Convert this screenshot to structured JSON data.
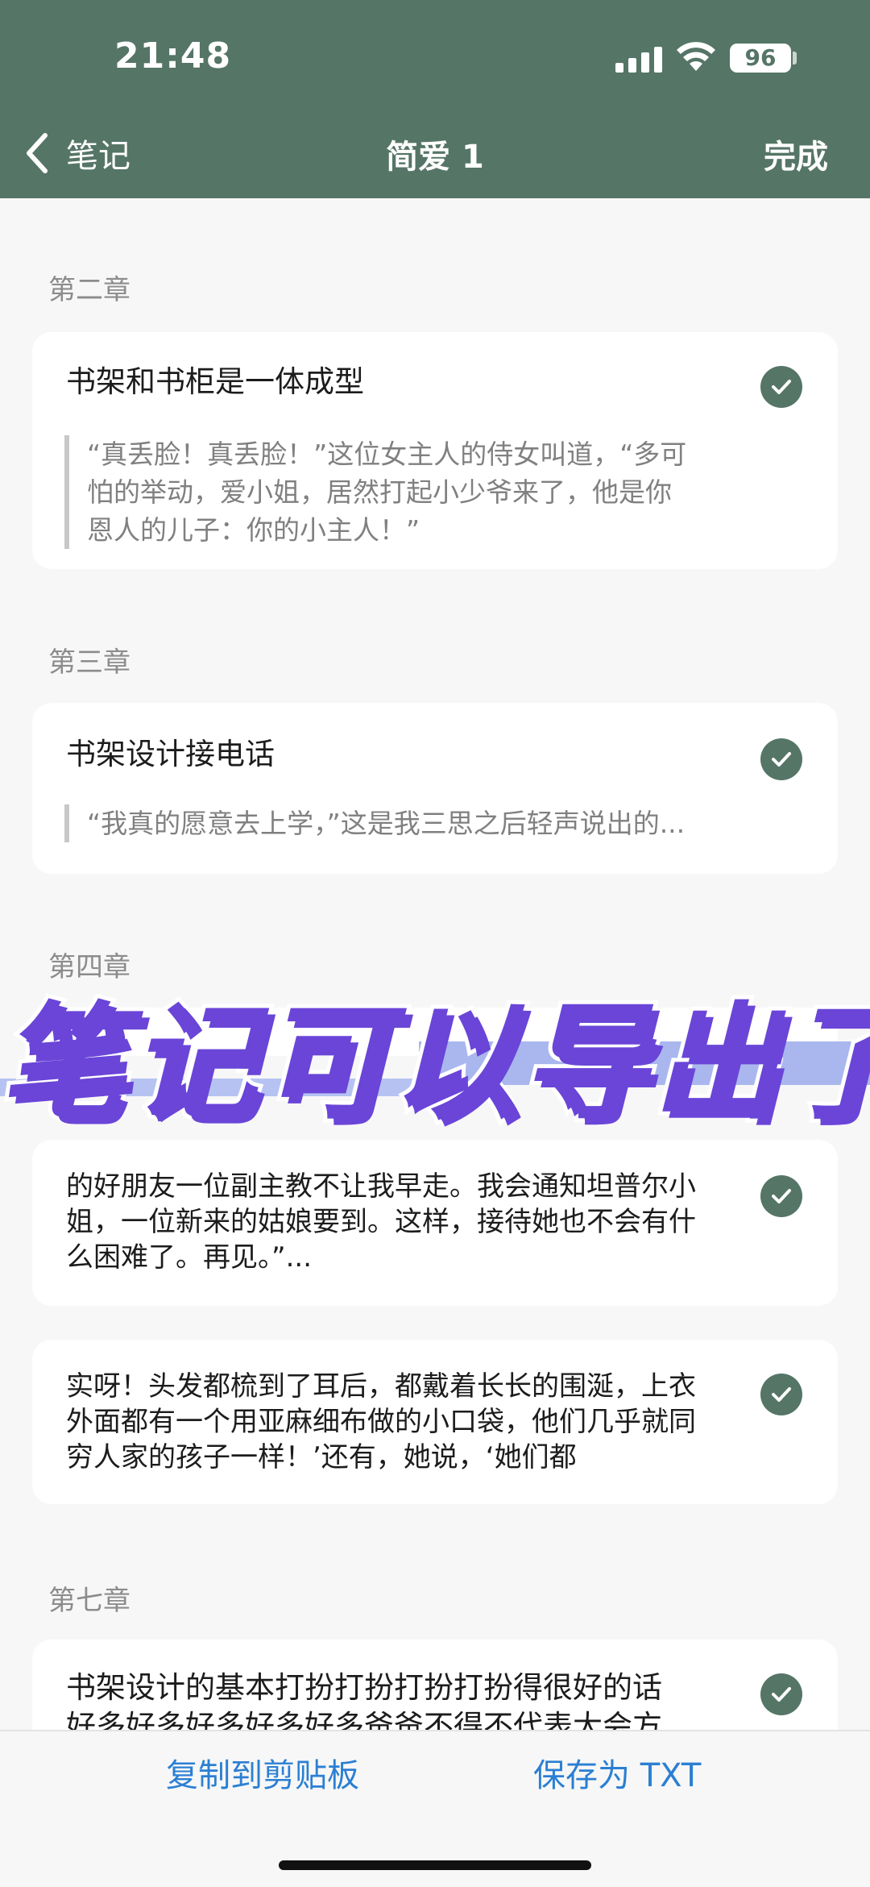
{
  "status": {
    "time": "21:48",
    "battery": "96"
  },
  "nav": {
    "back_label": "笔记",
    "title": "简爱 1",
    "done_label": "完成"
  },
  "sections": {
    "ch2": "第二章",
    "ch3": "第三章",
    "ch4": "第四章",
    "ch7": "第七章"
  },
  "notes": [
    {
      "title": "书架和书柜是一体成型",
      "quote": [
        "“真丢脸！真丢脸！”这位女主人的侍女叫道，“多可",
        "怕的举动，爱小姐，居然打起小少爷来了，他是你",
        "恩人的儿子：你的小主人！”"
      ]
    },
    {
      "title": "书架设计接电话",
      "quote": [
        "“我真的愿意去上学，”这是我三思之后轻声说出的..."
      ]
    },
    {
      "body": [
        "的好朋友一位副主教不让我早走。我会通知坦普尔小",
        "姐，一位新来的姑娘要到。这样，接待她也不会有什",
        "么困难了。再见。”..."
      ]
    },
    {
      "body": [
        "实呀！头发都梳到了耳后，都戴着长长的围涎，上衣",
        "外面都有一个用亚麻细布做的小口袋，他们几乎就同",
        "穷人家的孩子一样！’还有，她说，‘她们都"
      ]
    },
    {
      "title": "书架设计的基本打扮打扮打扮打扮得很好的话",
      "title2": "好多好多好多好多好多爸爸不得不代表大会方"
    }
  ],
  "overlay_text": "笔记可以导出了",
  "actions": {
    "copy": "复制到剪贴板",
    "save": "保存为 TXT"
  },
  "colors": {
    "header": "#557567",
    "accent": "#2b7fd3",
    "overlay": "#6a45d8"
  }
}
